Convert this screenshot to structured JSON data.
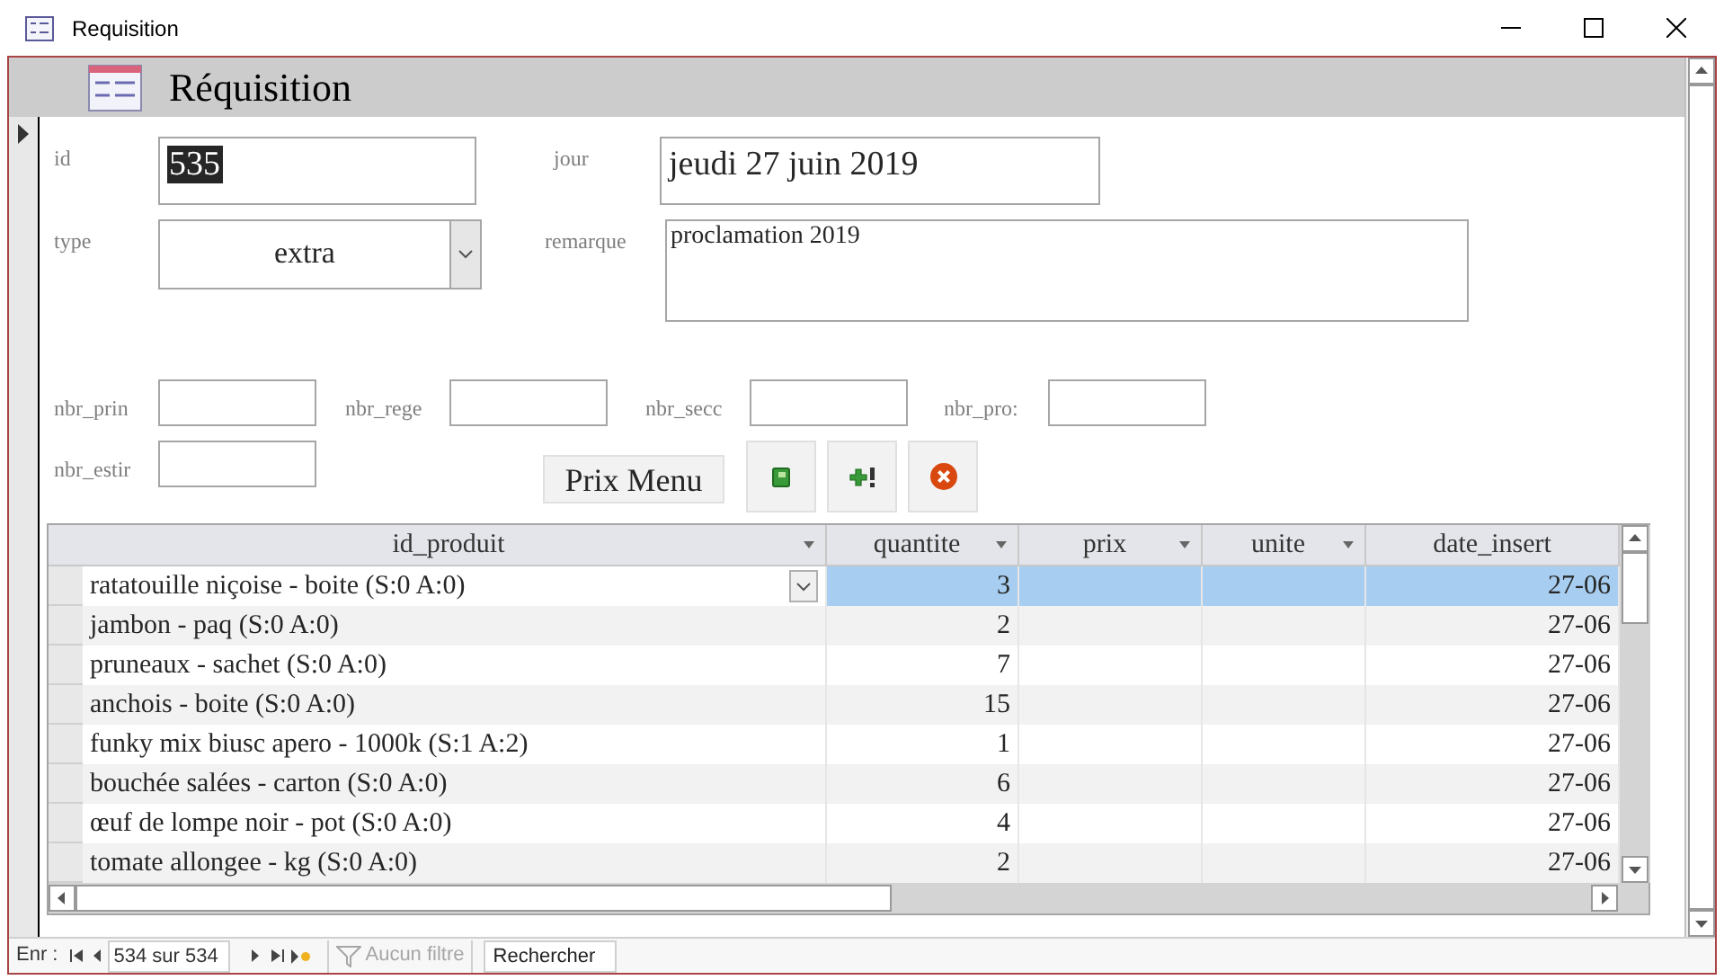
{
  "window": {
    "title": "Requisition"
  },
  "form": {
    "title": "Réquisition",
    "record_selector_current": true
  },
  "form_rows": [
    [
      {
        "kind": "text",
        "label": "id",
        "value": "535",
        "highlighted": true
      },
      {
        "kind": "text",
        "label": "jour",
        "value": "jeudi 27 juin 2019"
      }
    ],
    [
      {
        "kind": "combo",
        "label": "type",
        "value": "extra"
      },
      {
        "kind": "memo",
        "label": "remarque",
        "value": "proclamation 2019"
      }
    ],
    [
      {
        "kind": "small",
        "label": "nbr_prin"
      },
      {
        "kind": "small",
        "label": "nbr_rege"
      },
      {
        "kind": "small",
        "label": "nbr_secc"
      },
      {
        "kind": "small",
        "label": "nbr_pro:"
      }
    ],
    [
      {
        "kind": "small",
        "label": "nbr_estir"
      }
    ]
  ],
  "buttons": [
    {
      "kind": "text",
      "label": "Prix Menu"
    },
    {
      "kind": "book"
    },
    {
      "kind": "add"
    },
    {
      "kind": "cancel"
    }
  ],
  "datasheet": {
    "columns": [
      {
        "label": "id_produit",
        "dropdown": true
      },
      {
        "label": "quantite",
        "dropdown": true
      },
      {
        "label": "prix",
        "dropdown": true
      },
      {
        "label": "unite",
        "dropdown": true
      },
      {
        "label": "date_insert",
        "dropdown": false
      }
    ],
    "rows": [
      {
        "selected": true,
        "cells": [
          "ratatouille niçoise - boite (S:0 A:0)",
          "3",
          "",
          "",
          "27-06"
        ]
      },
      {
        "selected": false,
        "cells": [
          "jambon - paq (S:0 A:0)",
          "2",
          "",
          "",
          "27-06"
        ]
      },
      {
        "selected": false,
        "cells": [
          "pruneaux - sachet (S:0 A:0)",
          "7",
          "",
          "",
          "27-06"
        ]
      },
      {
        "selected": false,
        "cells": [
          "anchois - boite (S:0 A:0)",
          "15",
          "",
          "",
          "27-06"
        ]
      },
      {
        "selected": false,
        "cells": [
          "funky mix biusc apero - 1000k (S:1 A:2)",
          "1",
          "",
          "",
          "27-06"
        ]
      },
      {
        "selected": false,
        "cells": [
          "bouchée salées - carton (S:0 A:0)",
          "6",
          "",
          "",
          "27-06"
        ]
      },
      {
        "selected": false,
        "cells": [
          "œuf de lompe noir - pot (S:0 A:0)",
          "4",
          "",
          "",
          "27-06"
        ]
      },
      {
        "selected": false,
        "cells": [
          "tomate allongee - kg (S:0 A:0)",
          "2",
          "",
          "",
          "27-06"
        ]
      }
    ]
  },
  "navigation": {
    "label": "Enr :",
    "position": "534 sur 534",
    "filter": "Aucun filtre",
    "filter_disabled": true,
    "search": "Rechercher"
  }
}
